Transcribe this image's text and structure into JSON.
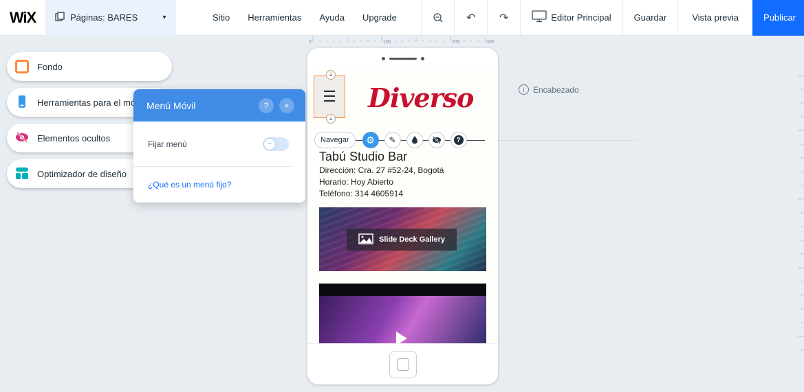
{
  "topbar": {
    "logo": "WiX",
    "pages_label": "Páginas: BARES",
    "menu": [
      "Sitio",
      "Herramientas",
      "Ayuda",
      "Upgrade"
    ],
    "editor_label": "Editor Principal",
    "save_label": "Guardar",
    "preview_label": "Vista previa",
    "publish_label": "Publicar"
  },
  "left_panel": {
    "items": [
      {
        "label": "Fondo",
        "color": "#fa8b3c"
      },
      {
        "label": "Herramientas para el móvil",
        "color": "#3899ec"
      },
      {
        "label": "Elementos ocultos",
        "color": "#d6337c"
      },
      {
        "label": "Optimizador de diseño",
        "color": "#00b0b8"
      }
    ]
  },
  "mobile_menu_popup": {
    "title": "Menú Móvil",
    "help": "?",
    "close": "×",
    "fix_menu_label": "Fijar menú",
    "help_link": "¿Qué es un menú fijo?"
  },
  "ruler": {
    "ticks": [
      "0",
      "100",
      "200",
      "300"
    ]
  },
  "site": {
    "logo_text": "Diverso",
    "bar_name": "Tabú Studio Bar",
    "address": "Dirección: Cra. 27 #52-24, Bogotá",
    "hours": "Horario: Hoy Abierto",
    "phone": "Teléfono: 314 4605914",
    "gallery_label": "Slide Deck Gallery"
  },
  "toolbar": {
    "navigate_label": "Navegar"
  },
  "canvas": {
    "header_section_label": "Encabezado"
  },
  "colors": {
    "accent": "#116dff",
    "popup_header": "#3f8be6",
    "logo_yellow": "#f2c21b",
    "logo_red": "#c8102e"
  }
}
